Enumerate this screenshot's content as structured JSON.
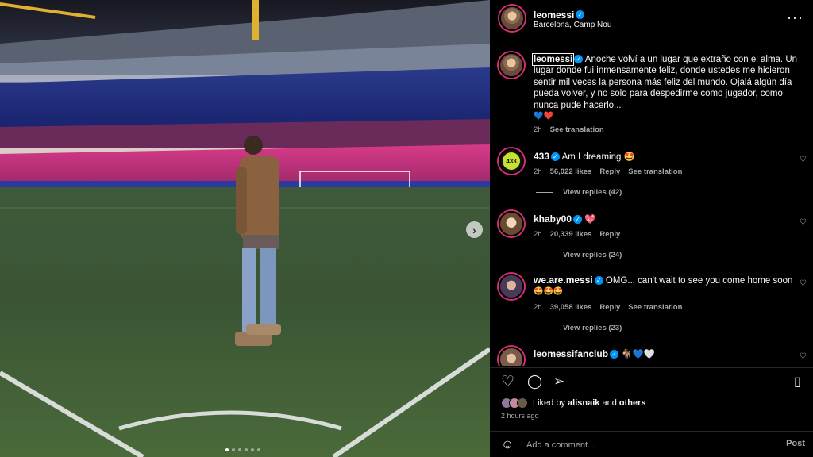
{
  "post": {
    "username": "leomessi",
    "location": "Barcelona, Camp Nou",
    "caption": "Anoche volví a un lugar que extraño con el alma. Un lugar donde fui inmensamente feliz, donde ustedes me hicieron sentir mil veces la persona más feliz del mundo. Ojalá algún día pueda volver, y no solo para despedirme como jugador, como nunca pude hacerlo...",
    "caption_emojis": "💙❤️",
    "caption_time": "2h",
    "see_translation": "See translation"
  },
  "comments": [
    {
      "user": "433",
      "text": "Am I dreaming 🤩",
      "time": "2h",
      "likes": "56,022 likes",
      "reply": "Reply",
      "translate": "See translation",
      "replies": "View replies (42)"
    },
    {
      "user": "khaby00",
      "text": "💖",
      "time": "2h",
      "likes": "20,339 likes",
      "reply": "Reply",
      "replies": "View replies (24)"
    },
    {
      "user": "we.are.messi",
      "text": "OMG... can't wait to see you come home soon",
      "text2": "🤩🤩🤩",
      "time": "2h",
      "likes": "39,058 likes",
      "reply": "Reply",
      "translate": "See translation",
      "replies": "View replies (23)"
    },
    {
      "user": "leomessifanclub",
      "text": "🐐💙🤍"
    }
  ],
  "actions": {
    "liked_by_prefix": "Liked by",
    "liked_by_user": "alisnaik",
    "liked_by_and": "and",
    "liked_by_others": "others",
    "time_ago": "2 hours ago"
  },
  "comment_box": {
    "placeholder": "Add a comment...",
    "post_label": "Post"
  },
  "icons": {
    "more": "more-options-icon",
    "heart": "heart-icon",
    "comment": "comment-icon",
    "share": "share-icon",
    "bookmark": "bookmark-icon",
    "emoji": "emoji-icon",
    "next": "chevron-right-icon"
  },
  "colors": {
    "verified": "#0095f6",
    "story_ring": "#d82e73",
    "muted_text": "#a8a8a8",
    "background": "#000000"
  }
}
